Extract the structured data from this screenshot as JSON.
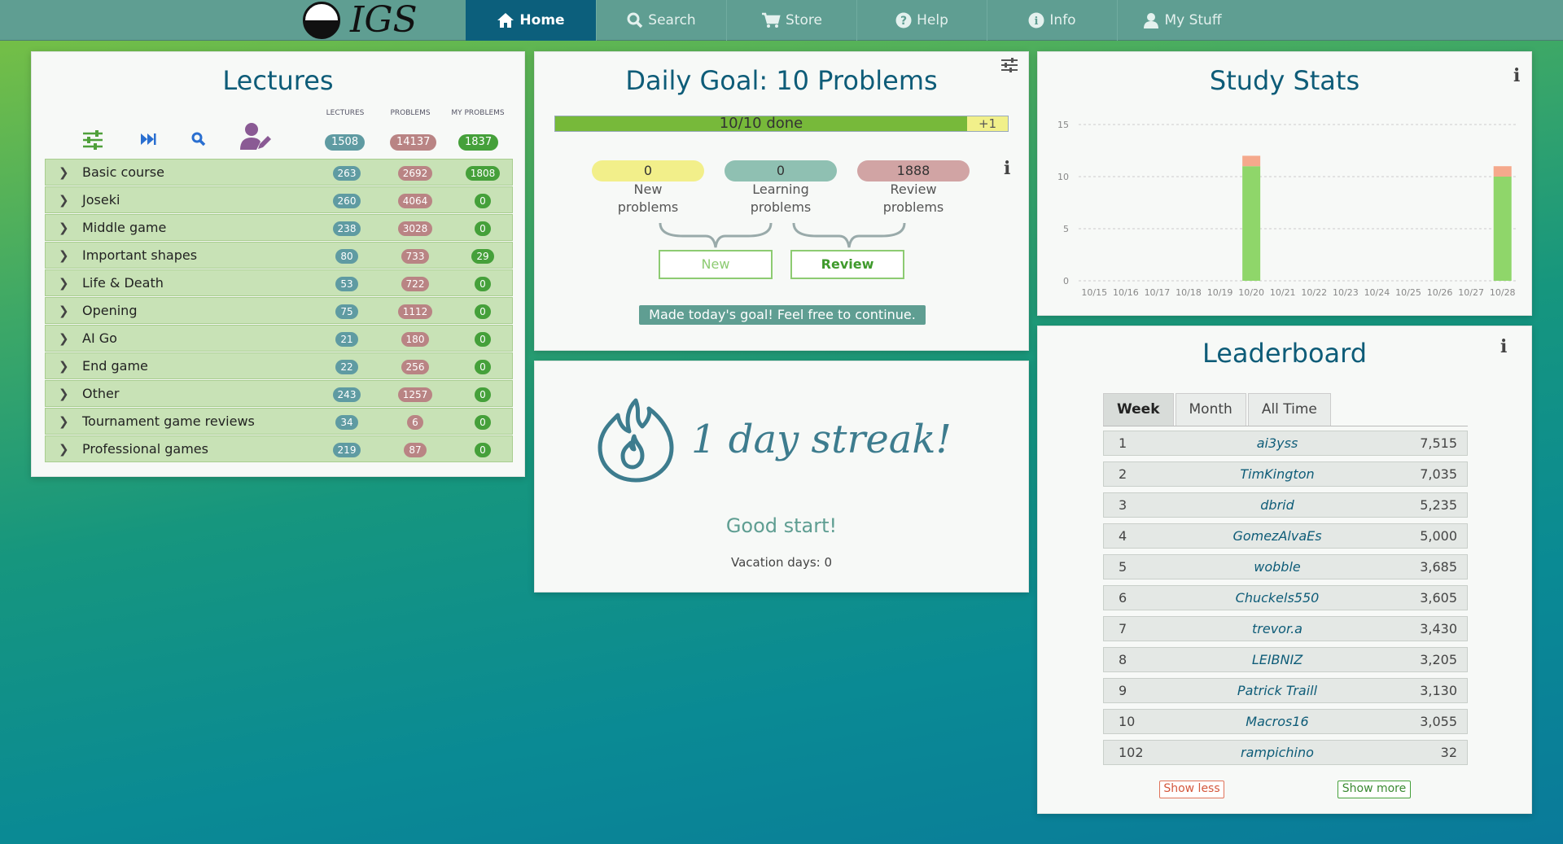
{
  "nav": {
    "logo_text": "IGS",
    "items": [
      {
        "label": "Home",
        "icon": "home-icon",
        "glyph": "⌂"
      },
      {
        "label": "Search",
        "icon": "search-icon",
        "glyph": "⚲"
      },
      {
        "label": "Store",
        "icon": "cart-icon",
        "glyph": "🛒"
      },
      {
        "label": "Help",
        "icon": "help-icon",
        "glyph": "?"
      },
      {
        "label": "Info",
        "icon": "info-icon",
        "glyph": "i"
      },
      {
        "label": "My Stuff",
        "icon": "user-icon",
        "glyph": "👤"
      }
    ]
  },
  "lectures": {
    "title": "Lectures",
    "col_lectures": "LECTURES",
    "col_problems": "PROBLEMS",
    "col_my_problems": "MY PROBLEMS",
    "total_lectures": "1508",
    "total_problems": "14137",
    "total_my_problems": "1837",
    "rows": [
      {
        "name": "Basic course",
        "lectures": "263",
        "problems": "2692",
        "my": "1808"
      },
      {
        "name": "Joseki",
        "lectures": "260",
        "problems": "4064",
        "my": "0"
      },
      {
        "name": "Middle game",
        "lectures": "238",
        "problems": "3028",
        "my": "0"
      },
      {
        "name": "Important shapes",
        "lectures": "80",
        "problems": "733",
        "my": "29"
      },
      {
        "name": "Life & Death",
        "lectures": "53",
        "problems": "722",
        "my": "0"
      },
      {
        "name": "Opening",
        "lectures": "75",
        "problems": "1112",
        "my": "0"
      },
      {
        "name": "AI Go",
        "lectures": "21",
        "problems": "180",
        "my": "0"
      },
      {
        "name": "End game",
        "lectures": "22",
        "problems": "256",
        "my": "0"
      },
      {
        "name": "Other",
        "lectures": "243",
        "problems": "1257",
        "my": "0"
      },
      {
        "name": "Tournament game reviews",
        "lectures": "34",
        "problems": "6",
        "my": "0"
      },
      {
        "name": "Professional games",
        "lectures": "219",
        "problems": "87",
        "my": "0"
      }
    ]
  },
  "daily": {
    "title": "Daily Goal: 10 Problems",
    "progress_label": "10/10 done",
    "progress_fraction": 1.0,
    "extra_label": "+1",
    "new_count": "0",
    "new_label_1": "New",
    "new_label_2": "problems",
    "learning_count": "0",
    "learning_label_1": "Learning",
    "learning_label_2": "problems",
    "review_count": "1888",
    "review_label_1": "Review",
    "review_label_2": "problems",
    "btn_new": "New",
    "btn_review": "Review",
    "message": "Made today's goal! Feel free to continue."
  },
  "streak": {
    "text": "1 day streak!",
    "subtitle": "Good start!",
    "vacation": "Vacation days: 0"
  },
  "stats": {
    "title": "Study Stats"
  },
  "chart_data": {
    "type": "bar",
    "title": "Study Stats",
    "categories": [
      "10/15",
      "10/16",
      "10/17",
      "10/18",
      "10/19",
      "10/20",
      "10/21",
      "10/22",
      "10/23",
      "10/24",
      "10/25",
      "10/26",
      "10/27",
      "10/28"
    ],
    "y_ticks": [
      "0",
      "5",
      "10",
      "15"
    ],
    "ylim": [
      0,
      15
    ],
    "grid": true,
    "series": [
      {
        "color": "#8fd66a",
        "values": [
          0,
          0,
          0,
          0,
          0,
          11,
          0,
          0,
          0,
          0,
          0,
          0,
          0,
          10
        ]
      },
      {
        "color": "#f5a98c",
        "values": [
          0,
          0,
          0,
          0,
          0,
          1,
          0,
          0,
          0,
          0,
          0,
          0,
          0,
          1
        ]
      }
    ]
  },
  "leaderboard": {
    "title": "Leaderboard",
    "tabs": [
      "Week",
      "Month",
      "All Time"
    ],
    "active_tab": "Week",
    "rows": [
      {
        "rank": "1",
        "name": "ai3yss",
        "score": "7,515"
      },
      {
        "rank": "2",
        "name": "TimKington",
        "score": "7,035"
      },
      {
        "rank": "3",
        "name": "dbrid",
        "score": "5,235"
      },
      {
        "rank": "4",
        "name": "GomezAlvaEs",
        "score": "5,000"
      },
      {
        "rank": "5",
        "name": "wobble",
        "score": "3,685"
      },
      {
        "rank": "6",
        "name": "Chuckels550",
        "score": "3,605"
      },
      {
        "rank": "7",
        "name": "trevor.a",
        "score": "3,430"
      },
      {
        "rank": "8",
        "name": "LEIBNIZ",
        "score": "3,205"
      },
      {
        "rank": "9",
        "name": "Patrick Traill",
        "score": "3,130"
      },
      {
        "rank": "10",
        "name": "Macros16",
        "score": "3,055"
      },
      {
        "rank": "102",
        "name": "rampichino",
        "score": "32"
      }
    ],
    "show_less": "Show less",
    "show_more": "Show more"
  },
  "colors": {
    "accent": "#0e5c78",
    "nav": "#5f9e92",
    "nav_active": "#0c5f7c",
    "green": "#45a03a",
    "rose": "#b98484",
    "teal": "#5f9ba2"
  }
}
